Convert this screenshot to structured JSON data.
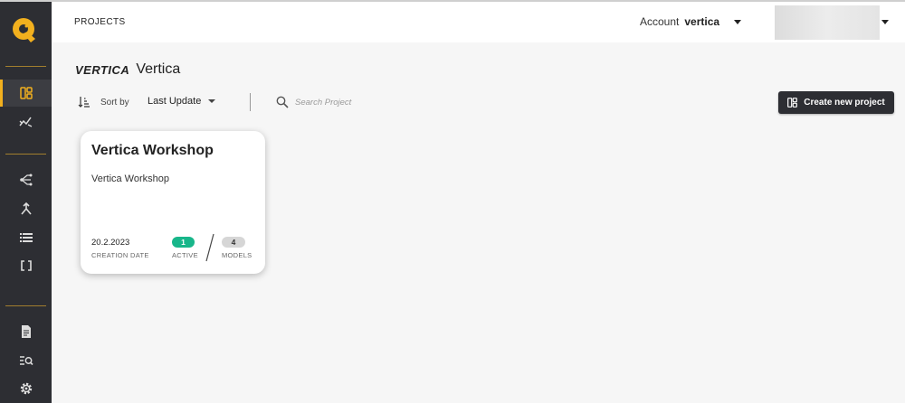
{
  "header": {
    "breadcrumb": "PROJECTS",
    "account_label": "Account",
    "account_name": "vertica"
  },
  "sidebar": {
    "items": [
      {
        "icon": "projects-icon",
        "active": true
      },
      {
        "icon": "analytics-icon",
        "active": false
      },
      {
        "icon": "flow-icon",
        "active": false
      },
      {
        "icon": "merge-icon",
        "active": false
      },
      {
        "icon": "list-icon",
        "active": false
      },
      {
        "icon": "brackets-icon",
        "active": false
      },
      {
        "icon": "document-icon",
        "active": false
      },
      {
        "icon": "search-list-icon",
        "active": false
      },
      {
        "icon": "gear-icon",
        "active": false
      }
    ]
  },
  "brand": {
    "logo_text": "VERTICA",
    "name": "Vertica"
  },
  "toolbar": {
    "sort_label": "Sort by",
    "sort_value": "Last Update",
    "search_placeholder": "Search Project",
    "create_label": "Create new project"
  },
  "projects": [
    {
      "title": "Vertica Workshop",
      "description": "Vertica Workshop",
      "creation_date": "20.2.2023",
      "creation_label": "CREATION DATE",
      "active_count": "1",
      "active_label": "ACTIVE",
      "models_count": "4",
      "models_label": "MODELS"
    }
  ],
  "colors": {
    "sidebar_bg": "#2d2e33",
    "accent": "#f2b01e",
    "active_pill": "#18b68a"
  }
}
